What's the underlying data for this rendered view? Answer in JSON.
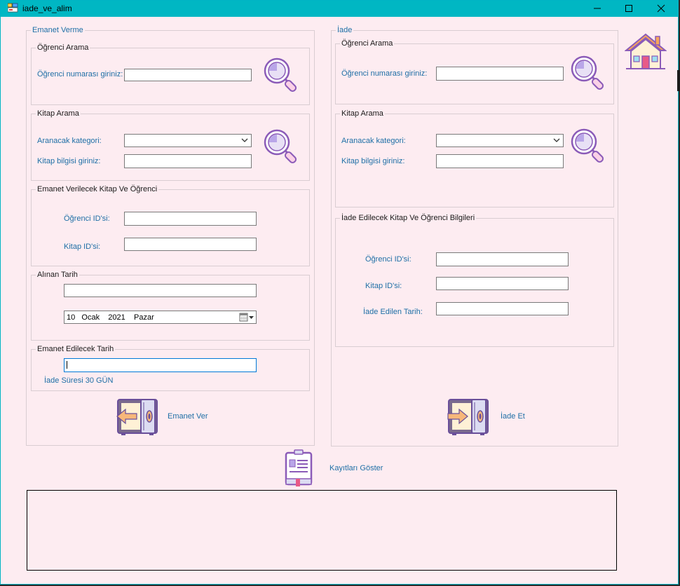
{
  "window": {
    "title": "iade_ve_alim"
  },
  "emanet": {
    "title": "Emanet Verme",
    "ogrenci_arama": {
      "title": "Öğrenci Arama",
      "label": "Öğrenci numarası giriniz:",
      "value": ""
    },
    "kitap_arama": {
      "title": "Kitap Arama",
      "kategori_label": "Aranacak kategori:",
      "kategori_value": "",
      "bilgi_label": "Kitap bilgisi giriniz:",
      "bilgi_value": ""
    },
    "verilecek": {
      "title": "Emanet Verilecek Kitap Ve Öğrenci",
      "ogrenci_label": "Öğrenci ID'si:",
      "ogrenci_value": "",
      "kitap_label": "Kitap ID'si:",
      "kitap_value": ""
    },
    "alinan_tarih": {
      "title": "Alınan Tarih",
      "value": "",
      "date_text": "10   Ocak    2021    Pazar"
    },
    "edilecek_tarih": {
      "title": "Emanet Edilecek Tarih",
      "value": "",
      "note": "İade Süresi 30 GÜN"
    },
    "button_label": "Emanet Ver"
  },
  "iade": {
    "title": "İade",
    "ogrenci_arama": {
      "title": "Öğrenci Arama",
      "label": "Öğrenci numarası giriniz:",
      "value": ""
    },
    "kitap_arama": {
      "title": "Kitap Arama",
      "kategori_label": "Aranacak kategori:",
      "kategori_value": "",
      "bilgi_label": "Kitap bilgisi giriniz:",
      "bilgi_value": ""
    },
    "bilgiler": {
      "title": "İade Edilecek Kitap Ve Öğrenci  Bilgileri",
      "ogrenci_label": "Öğrenci ID'si:",
      "ogrenci_value": "",
      "kitap_label": "Kitap ID'si:",
      "kitap_value": "",
      "tarih_label": "İade Edilen Tarih:",
      "tarih_value": ""
    },
    "button_label": "İade Et"
  },
  "kayitlar_label": "Kayıtları Göster",
  "icons": {
    "app": "app-icon",
    "minimize": "minimize-icon",
    "maximize": "maximize-icon",
    "close": "close-icon",
    "search": "magnifier-icon",
    "home": "home-icon",
    "lend": "safe-arrow-left-icon",
    "return": "safe-arrow-right-icon",
    "records": "clipboard-list-icon",
    "calendar": "calendar-dropdown-icon",
    "dropdown": "chevron-down-icon"
  },
  "colors": {
    "titlebar": "#00b7c3",
    "background": "#fdecf1",
    "label": "#1e6fa6",
    "icon_purple": "#8b5bb8"
  }
}
